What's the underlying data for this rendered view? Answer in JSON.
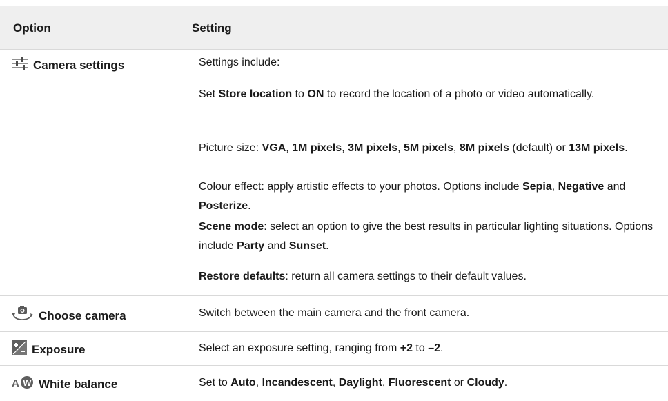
{
  "header": {
    "option": "Option",
    "setting": "Setting"
  },
  "rows": [
    {
      "icon": "sliders-icon",
      "label": "Camera settings",
      "paragraphs": [
        [
          {
            "t": "Settings include:"
          }
        ],
        [
          {
            "t": "Set "
          },
          {
            "t": "Store location",
            "b": true
          },
          {
            "t": " to "
          },
          {
            "t": "ON",
            "b": true
          },
          {
            "t": " to record the location of a photo or video automatically."
          }
        ],
        [
          {
            "t": "Picture size: "
          },
          {
            "t": "VGA",
            "b": true
          },
          {
            "t": ", "
          },
          {
            "t": "1M pixels",
            "b": true
          },
          {
            "t": ", "
          },
          {
            "t": "3M pixels",
            "b": true
          },
          {
            "t": ", "
          },
          {
            "t": "5M pixels",
            "b": true
          },
          {
            "t": ", "
          },
          {
            "t": "8M pixels",
            "b": true
          },
          {
            "t": " (default) or "
          },
          {
            "t": "13M pixels",
            "b": true
          },
          {
            "t": "."
          }
        ],
        [
          {
            "t": "Colour effect: apply artistic effects to your photos. Options include "
          },
          {
            "t": "Sepia",
            "b": true
          },
          {
            "t": ", "
          },
          {
            "t": "Negative",
            "b": true
          },
          {
            "t": " and "
          },
          {
            "t": "Posterize",
            "b": true
          },
          {
            "t": "."
          }
        ],
        [
          {
            "t": "Scene mode",
            "b": true
          },
          {
            "t": ": select an option to give the best results in particular lighting situations. Options include "
          },
          {
            "t": "Party",
            "b": true
          },
          {
            "t": " and "
          },
          {
            "t": "Sunset",
            "b": true
          },
          {
            "t": "."
          }
        ],
        [
          {
            "t": "Restore defaults",
            "b": true
          },
          {
            "t": ": return all camera settings to their default values."
          }
        ]
      ]
    },
    {
      "icon": "switch-camera-icon",
      "label": "Choose camera",
      "paragraphs": [
        [
          {
            "t": "Switch between the main camera and the front camera."
          }
        ]
      ]
    },
    {
      "icon": "exposure-icon",
      "label": "Exposure",
      "paragraphs": [
        [
          {
            "t": "Select an exposure setting, ranging from "
          },
          {
            "t": "+2",
            "b": true
          },
          {
            "t": " to "
          },
          {
            "t": "–2",
            "b": true
          },
          {
            "t": "."
          }
        ]
      ]
    },
    {
      "icon": "white-balance-auto-icon",
      "label": "White balance",
      "paragraphs": [
        [
          {
            "t": "Set to "
          },
          {
            "t": "Auto",
            "b": true
          },
          {
            "t": ", "
          },
          {
            "t": "Incandescent",
            "b": true
          },
          {
            "t": ", "
          },
          {
            "t": "Daylight",
            "b": true
          },
          {
            "t": ", "
          },
          {
            "t": "Fluorescent",
            "b": true
          },
          {
            "t": " or "
          },
          {
            "t": "Cloudy",
            "b": true
          },
          {
            "t": "."
          }
        ]
      ]
    }
  ]
}
